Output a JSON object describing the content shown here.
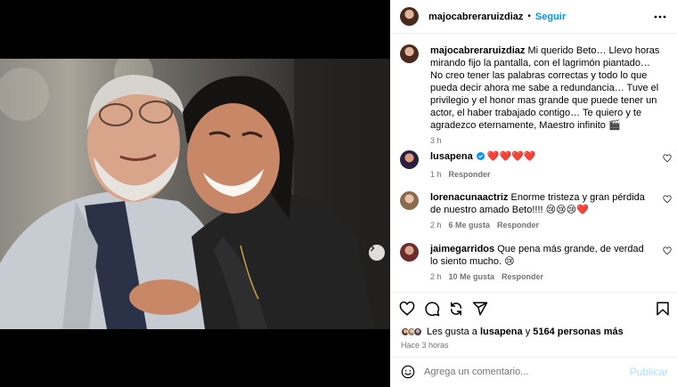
{
  "post": {
    "author": "majocabreraruizdiaz",
    "separator": "•",
    "follow_label": "Seguir",
    "caption_user": "majocabreraruizdiaz",
    "caption_text": "Mi querido Beto… Llevo horas mirando fijo la pantalla, con el lagrimón piantado… No creo tener las palabras correctas y todo lo que pueda decir ahora me sabe a redundancia… Tuve el privilegio y el honor mas grande que puede tener un actor, el haber trabajado contigo… Te quiero y te agradezco eternamente, Maestro infinito 🎬",
    "caption_time": "3 h"
  },
  "comments": [
    {
      "user": "lusapena",
      "verified": true,
      "text": "❤️❤️❤️❤️",
      "time": "1 h",
      "likes": "",
      "reply": "Responder"
    },
    {
      "user": "lorenacunaactriz",
      "verified": false,
      "text": "Enorme tristeza y gran pérdida de nuestro amado Beto!!!! 😢😢😢❤️",
      "time": "2 h",
      "likes": "6 Me gusta",
      "reply": "Responder"
    },
    {
      "user": "jaimegarridos",
      "verified": false,
      "text": "Que pena más grande, de verdad lo siento mucho. 😢",
      "time": "2 h",
      "likes": "10 Me gusta",
      "reply": "Responder"
    }
  ],
  "likes": {
    "prefix": "Les gusta a",
    "user": "lusapena",
    "conj": "y",
    "others": "5164 personas más"
  },
  "time_ago": "Hace 3 horas",
  "compose": {
    "placeholder": "Agrega un comentario...",
    "post_label": "Publicar"
  },
  "carousel": {
    "count": 3,
    "active_index": 0
  },
  "colors": {
    "accent": "#0095f6",
    "muted": "#737373",
    "publish_disabled": "#b2dffc",
    "verified": "#0095f6"
  },
  "icons": [
    "more-icon",
    "heart-icon",
    "comment-icon",
    "share-icon",
    "send-icon",
    "bookmark-icon",
    "emoji-icon",
    "chevron-right-icon",
    "verified-icon"
  ]
}
